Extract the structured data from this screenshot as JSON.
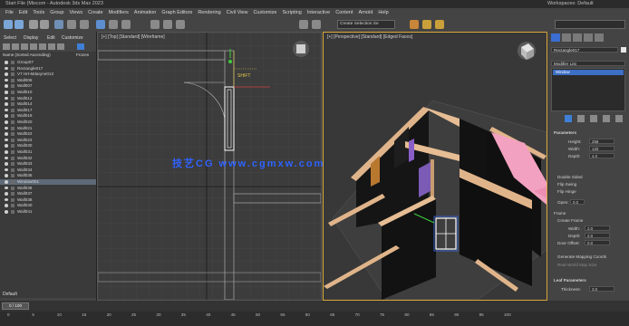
{
  "title_bar": {
    "app_title": "Start File (Mixcom - Autodesk 3ds Max 2023",
    "workspace": "Workspaces: Default"
  },
  "menu": [
    "File",
    "Edit",
    "Tools",
    "Group",
    "Views",
    "Create",
    "Modifiers",
    "Animation",
    "Graph Editors",
    "Rendering",
    "Civil View",
    "Customize",
    "Scripting",
    "Interactive",
    "Content",
    "Arnold",
    "Help"
  ],
  "toolbar": {
    "selection_set_placeholder": "Create Selection Se"
  },
  "explorer": {
    "tabs": [
      "Select",
      "Display",
      "Edit",
      "Customize"
    ],
    "root": "Name (Sorted Ascending)",
    "frozen_header": "Frozen",
    "items": [
      "Group07",
      "Rectangle017",
      "V7 Hrt-Mdaryne013",
      "Wall006",
      "Wall007",
      "Wall010",
      "Wall012",
      "Wall014",
      "Wall017",
      "Wall019",
      "Wall020",
      "Wall021",
      "Wall022",
      "Wall023",
      "Wall030",
      "Wall031",
      "Wall032",
      "Wall033",
      "Wall034",
      "Wall035",
      "Window001",
      "Wall036",
      "Wall037",
      "Wall038",
      "Wall040",
      "Wall041"
    ],
    "selected_index": 20,
    "footer_label": "Default"
  },
  "viewports": {
    "top_label": "[+] [Top] [Standard] [Wireframe]",
    "persp_label": "[+] [Perspective] [Standard] [Edged Faces]",
    "snap_label": "SHIFT"
  },
  "watermark": "技艺CG   www.cgmxw.com",
  "command_panel": {
    "object_name": "Rectangle017",
    "modifier_list": "Modifier List",
    "modifier_item": "Window",
    "section_parameters": "Parameters",
    "height_label": "Height:",
    "height_value": "258",
    "width_label": "Width:",
    "width_value": "120",
    "depth_label": "Depth:",
    "depth_value": "4.0",
    "open_label": "Open:",
    "open_value": "0.0",
    "checks": [
      "Double Sided",
      "Flip Swing",
      "Flip Hinge"
    ],
    "frame_label": "Frame",
    "create_frame": "Create Frame",
    "frame_width_label": "Width:",
    "frame_width_value": "2.0",
    "frame_depth_label": "Depth:",
    "frame_depth_value": "2.0",
    "door_offset_label": "Door Offset:",
    "door_offset_value": "0.0",
    "gen_mapping": "Generate Mapping Coords",
    "real_world": "Real-World Map Size",
    "section_leaf": "Leaf Parameters",
    "thickness_label": "Thickness:",
    "thickness_value": "3.0"
  },
  "timeline": {
    "frame_readout": "0 / 100",
    "ticks": [
      "0",
      "5",
      "10",
      "15",
      "20",
      "25",
      "30",
      "35",
      "40",
      "45",
      "50",
      "55",
      "60",
      "65",
      "70",
      "75",
      "80",
      "85",
      "90",
      "95",
      "100"
    ]
  }
}
